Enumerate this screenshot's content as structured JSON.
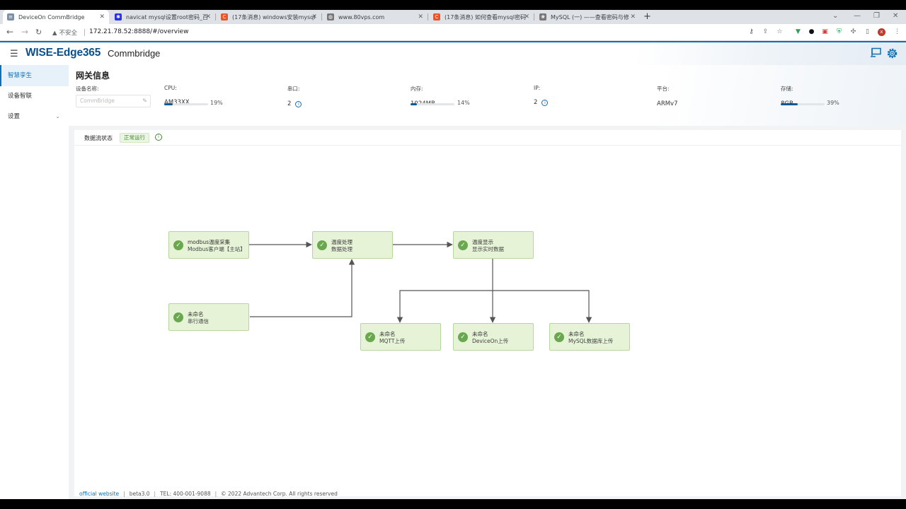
{
  "browser": {
    "tabs": [
      {
        "title": "DeviceOn CommBridge",
        "active": true,
        "favicon_color": "#7b8fa6",
        "favicon": "≡"
      },
      {
        "title": "navicat mysql设置root密码_百",
        "active": false,
        "favicon_color": "#2932e1",
        "favicon": "✱"
      },
      {
        "title": "(17条消息) windows安装mysql",
        "active": false,
        "favicon_color": "#e4572e",
        "favicon": "C"
      },
      {
        "title": "www.80vps.com",
        "active": false,
        "favicon_color": "#777777",
        "favicon": "◍"
      },
      {
        "title": "(17条消息) 如何查看mysql密码",
        "active": false,
        "favicon_color": "#e4572e",
        "favicon": "C"
      },
      {
        "title": "MySQL (一) ——查看密码与修",
        "active": false,
        "favicon_color": "#777777",
        "favicon": "❀"
      }
    ],
    "new_tab": "+",
    "security_label": "不安全",
    "url": "172.21.78.52:8888/#/overview"
  },
  "header": {
    "logo": "WISE-Edge365",
    "product": "Commbridge"
  },
  "sidebar": {
    "items": [
      {
        "label": "智慧孪生",
        "active": true
      },
      {
        "label": "设备智联",
        "active": false
      },
      {
        "label": "设置",
        "active": false,
        "expandable": true
      }
    ]
  },
  "gateway": {
    "title": "网关信息",
    "device_name": {
      "label": "设备名称:",
      "placeholder": "CommBridge"
    },
    "cpu": {
      "label": "CPU:",
      "value": "AM33XX",
      "percent_label": "19%",
      "percent": 19
    },
    "serial": {
      "label": "串口:",
      "value": "2"
    },
    "memory": {
      "label": "内存:",
      "value": "1024MB",
      "percent_label": "14%",
      "percent": 14
    },
    "ip": {
      "label": "IP:",
      "value": "2"
    },
    "platform": {
      "label": "平台:",
      "value": "ARMv7"
    },
    "storage": {
      "label": "存储:",
      "value": "8GB",
      "percent_label": "39%",
      "percent": 39
    }
  },
  "dataflow": {
    "title": "数据流状态",
    "status": "正常运行",
    "nodes": [
      {
        "id": "n1",
        "name": "modbus温度采集",
        "sub": "Modbus客户端【主站】"
      },
      {
        "id": "n2",
        "name": "温度处理",
        "sub": "数据处理"
      },
      {
        "id": "n3",
        "name": "温度显示",
        "sub": "显示实时数据"
      },
      {
        "id": "n4",
        "name": "未命名",
        "sub": "串行通信"
      },
      {
        "id": "n5",
        "name": "未命名",
        "sub": "MQTT上传"
      },
      {
        "id": "n6",
        "name": "未命名",
        "sub": "DeviceOn上传"
      },
      {
        "id": "n7",
        "name": "未命名",
        "sub": "MySQL数据库上传"
      }
    ]
  },
  "footer": {
    "website": "official website",
    "version": "beta3.0",
    "tel": "TEL: 400-001-9088",
    "copyright": "© 2022 Advantech Corp. All rights reserved"
  }
}
